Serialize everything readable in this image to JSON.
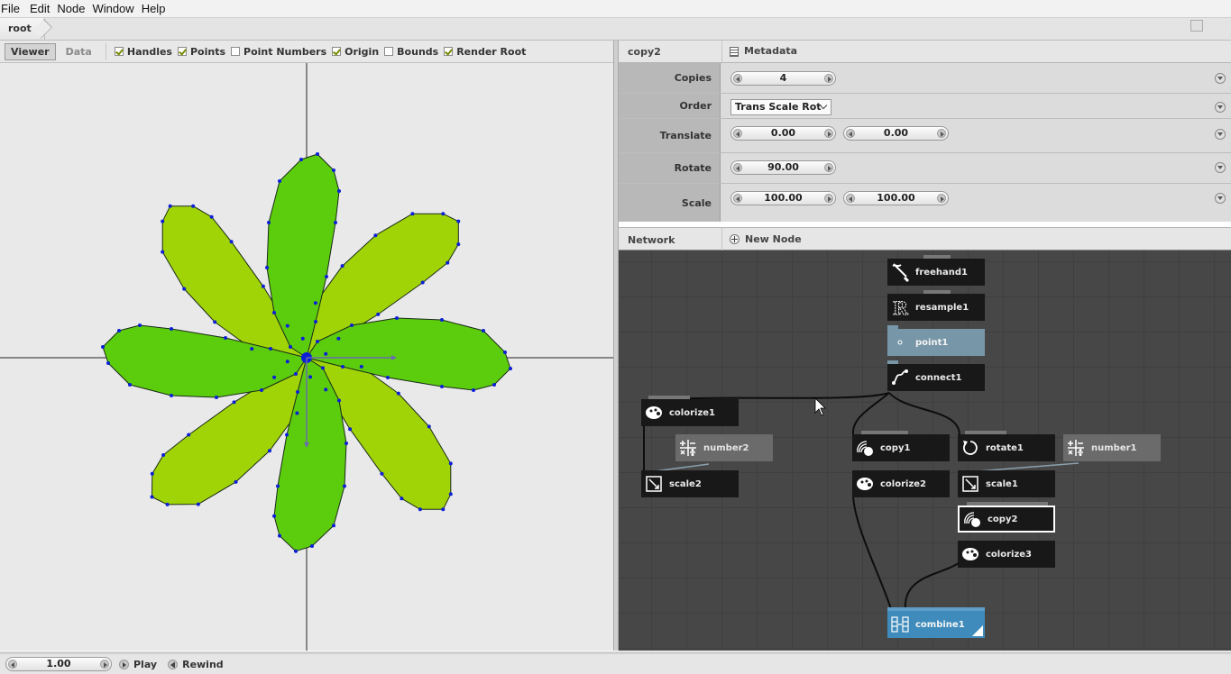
{
  "menubar": {
    "items": [
      "File",
      "Edit",
      "Node",
      "Window",
      "Help"
    ]
  },
  "breadcrumb": {
    "root": "root"
  },
  "viewer_toolbar": {
    "tabs": [
      {
        "label": "Viewer",
        "active": true
      },
      {
        "label": "Data",
        "active": false
      }
    ],
    "toggles": [
      {
        "label": "Handles",
        "checked": true
      },
      {
        "label": "Points",
        "checked": true
      },
      {
        "label": "Point Numbers",
        "checked": false
      },
      {
        "label": "Origin",
        "checked": true
      },
      {
        "label": "Bounds",
        "checked": false
      },
      {
        "label": "Render Root",
        "checked": true
      }
    ]
  },
  "parameters": {
    "node_name": "copy2",
    "metadata_label": "Metadata",
    "copies": {
      "label": "Copies",
      "value": "4"
    },
    "order": {
      "label": "Order",
      "value": "Trans Scale Rot"
    },
    "translate": {
      "label": "Translate",
      "x": "0.00",
      "y": "0.00"
    },
    "rotate": {
      "label": "Rotate",
      "value": "90.00"
    },
    "scale": {
      "label": "Scale",
      "x": "100.00",
      "y": "100.00"
    }
  },
  "network": {
    "title": "Network",
    "new_node": "New Node",
    "nodes": {
      "freehand1": "freehand1",
      "resample1": "resample1",
      "point1": "point1",
      "connect1": "connect1",
      "colorize1": "colorize1",
      "number2": "number2",
      "scale2": "scale2",
      "copy1": "copy1",
      "colorize2": "colorize2",
      "rotate1": "rotate1",
      "number1": "number1",
      "scale1": "scale1",
      "copy2": "copy2",
      "colorize3": "colorize3",
      "combine1": "combine1"
    }
  },
  "playback": {
    "frame": "1.00",
    "play": "Play",
    "rewind": "Rewind"
  },
  "colors": {
    "petal_dark": "#5ccd0c",
    "petal_light": "#a1d407",
    "point": "#0b1fd6",
    "combine_node": "#3f8cbc",
    "render_node": "#7796a8"
  }
}
